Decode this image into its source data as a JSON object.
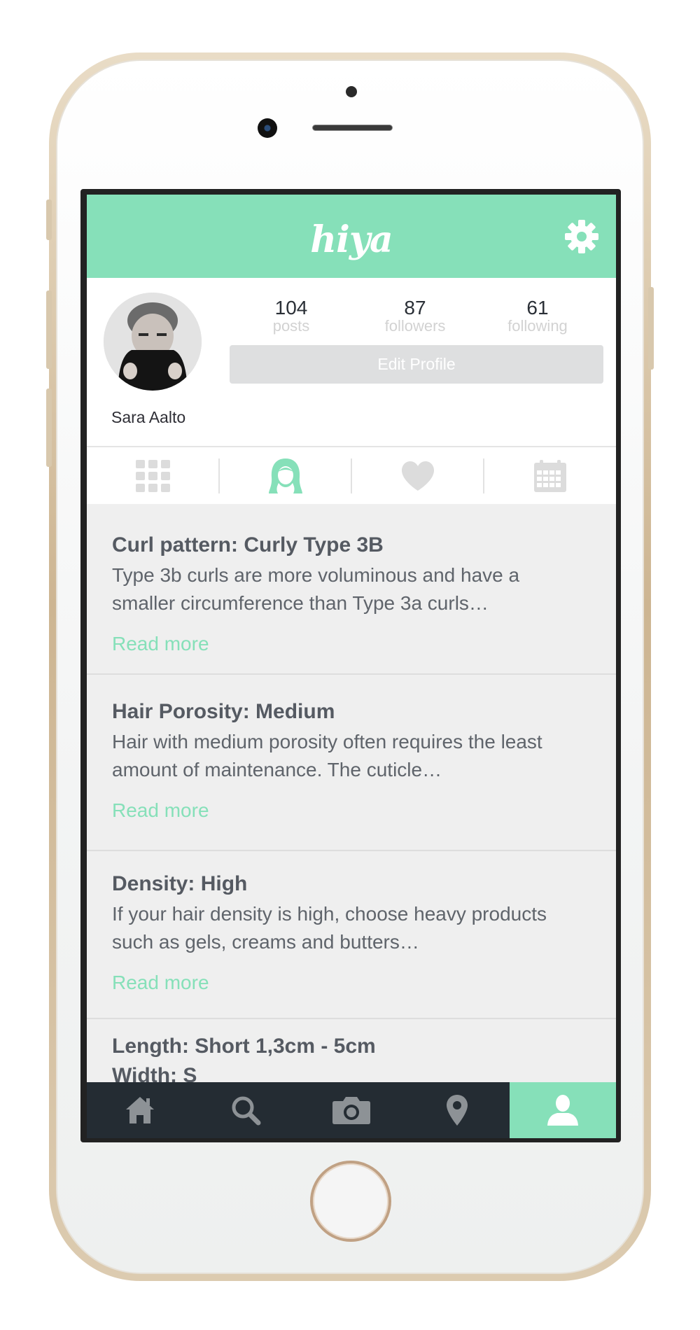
{
  "app": {
    "logo": "hiya"
  },
  "colors": {
    "accent": "#86e0b9",
    "nav_bg": "#242c33",
    "text": "#555a62"
  },
  "header": {
    "settings_icon": "gear-icon"
  },
  "profile": {
    "name": "Sara Aalto",
    "stats": [
      {
        "value": "104",
        "label": "posts"
      },
      {
        "value": "87",
        "label": "followers"
      },
      {
        "value": "61",
        "label": "following"
      }
    ],
    "edit_button_label": "Edit Profile"
  },
  "profile_tabs": [
    {
      "icon": "grid-icon",
      "active": false
    },
    {
      "icon": "hair-profile-icon",
      "active": true
    },
    {
      "icon": "heart-icon",
      "active": false
    },
    {
      "icon": "calendar-icon",
      "active": false
    }
  ],
  "cards": [
    {
      "title": "Curl pattern: Curly Type 3B",
      "body": "Type 3b curls are more voluminous and have a smaller circumference than Type 3a curls…",
      "link": "Read more"
    },
    {
      "title": "Hair Porosity: Medium",
      "body": "Hair with medium porosity often requires the least amount of maintenance. The cuticle…",
      "link": "Read more"
    },
    {
      "title": "Density: High",
      "body": "If your hair density is high, choose heavy products such as gels, creams and butters…",
      "link": "Read more"
    },
    {
      "title": "Length: Short 1,3cm - 5cm",
      "extra": "Width: S"
    }
  ],
  "bottom_nav": [
    {
      "icon": "home-icon",
      "active": false
    },
    {
      "icon": "search-icon",
      "active": false
    },
    {
      "icon": "camera-icon",
      "active": false
    },
    {
      "icon": "location-pin-icon",
      "active": false
    },
    {
      "icon": "profile-icon",
      "active": true
    }
  ]
}
